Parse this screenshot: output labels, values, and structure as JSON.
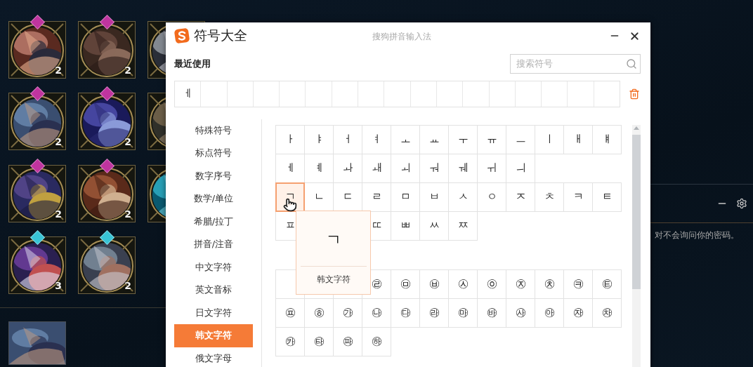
{
  "background": {
    "tiles": [
      {
        "kind": "champion",
        "count": "2",
        "color": "#c0349f"
      },
      {
        "kind": "champion",
        "count": "2",
        "color": "#c0349f"
      },
      {
        "kind": "picture"
      },
      {
        "kind": "champion",
        "count": "2",
        "color": "#c0349f"
      },
      {
        "kind": "champion",
        "count": "2",
        "color": "#c0349f"
      },
      {
        "kind": "picture"
      },
      {
        "kind": "champion",
        "count": "2",
        "color": "#c0349f"
      },
      {
        "kind": "champion",
        "count": "2",
        "color": "#c0349f"
      },
      {
        "kind": "picture"
      },
      {
        "kind": "champion",
        "count": "3",
        "color": "#38c4d6"
      },
      {
        "kind": "champion",
        "count": "2",
        "color": "#38c4d6"
      }
    ],
    "side_panel": {
      "notice": "对不会询问你的密码。"
    }
  },
  "dialog": {
    "title": "符号大全",
    "subtitle": "搜狗拼音输入法",
    "recent": {
      "label": "最近使用",
      "items": [
        "ㅔ"
      ]
    },
    "search": {
      "placeholder": "搜索符号"
    },
    "categories": [
      {
        "label": "特殊符号",
        "selected": false
      },
      {
        "label": "标点符号",
        "selected": false
      },
      {
        "label": "数字序号",
        "selected": false
      },
      {
        "label": "数学/单位",
        "selected": false
      },
      {
        "label": "希腊/拉丁",
        "selected": false
      },
      {
        "label": "拼音/注音",
        "selected": false
      },
      {
        "label": "中文字符",
        "selected": false
      },
      {
        "label": "英文音标",
        "selected": false
      },
      {
        "label": "日文字符",
        "selected": false
      },
      {
        "label": "韩文字符",
        "selected": true
      },
      {
        "label": "俄文字母",
        "selected": false
      }
    ],
    "groups": [
      {
        "cells": [
          {
            "kind": "char",
            "char": "ㅏ",
            "hovered": false
          },
          {
            "kind": "char",
            "char": "ㅑ",
            "hovered": false
          },
          {
            "kind": "char",
            "char": "ㅓ",
            "hovered": false
          },
          {
            "kind": "char",
            "char": "ㅕ",
            "hovered": false
          },
          {
            "kind": "char",
            "char": "ㅗ",
            "hovered": false
          },
          {
            "kind": "char",
            "char": "ㅛ",
            "hovered": false
          },
          {
            "kind": "char",
            "char": "ㅜ",
            "hovered": false
          },
          {
            "kind": "char",
            "char": "ㅠ",
            "hovered": false
          },
          {
            "kind": "char",
            "char": "ㅡ",
            "hovered": false
          },
          {
            "kind": "char",
            "char": "ㅣ",
            "hovered": false
          },
          {
            "kind": "char",
            "char": "ㅐ",
            "hovered": false
          },
          {
            "kind": "char",
            "char": "ㅒ",
            "hovered": false
          },
          {
            "kind": "char",
            "char": "ㅔ",
            "hovered": false
          },
          {
            "kind": "char",
            "char": "ㅖ",
            "hovered": false
          },
          {
            "kind": "char",
            "char": "ㅘ",
            "hovered": false
          },
          {
            "kind": "char",
            "char": "ㅙ",
            "hovered": false
          },
          {
            "kind": "char",
            "char": "ㅚ",
            "hovered": false
          },
          {
            "kind": "char",
            "char": "ㅝ",
            "hovered": false
          },
          {
            "kind": "char",
            "char": "ㅞ",
            "hovered": false
          },
          {
            "kind": "char",
            "char": "ㅟ",
            "hovered": false
          },
          {
            "kind": "char",
            "char": "ㅢ",
            "hovered": false
          },
          {
            "kind": "break"
          },
          {
            "kind": "char",
            "char": "ㄱ",
            "hovered": true
          },
          {
            "kind": "char",
            "char": "ㄴ",
            "hovered": false
          },
          {
            "kind": "char",
            "char": "ㄷ",
            "hovered": false
          },
          {
            "kind": "char",
            "char": "ㄹ",
            "hovered": false
          },
          {
            "kind": "char",
            "char": "ㅁ",
            "hovered": false
          },
          {
            "kind": "char",
            "char": "ㅂ",
            "hovered": false
          },
          {
            "kind": "char",
            "char": "ㅅ",
            "hovered": false
          },
          {
            "kind": "char",
            "char": "ㅇ",
            "hovered": false
          },
          {
            "kind": "char",
            "char": "ㅈ",
            "hovered": false
          },
          {
            "kind": "char",
            "char": "ㅊ",
            "hovered": false
          },
          {
            "kind": "char",
            "char": "ㅋ",
            "hovered": false
          },
          {
            "kind": "char",
            "char": "ㅌ",
            "hovered": false
          },
          {
            "kind": "char",
            "char": "ㅍ",
            "hovered": false
          },
          {
            "kind": "covered"
          },
          {
            "kind": "covered"
          },
          {
            "kind": "char",
            "char": "ㄸ",
            "hovered": false
          },
          {
            "kind": "char",
            "char": "ㅃ",
            "hovered": false
          },
          {
            "kind": "char",
            "char": "ㅆ",
            "hovered": false
          },
          {
            "kind": "char",
            "char": "ㅉ",
            "hovered": false
          }
        ]
      },
      {
        "cells": [
          {
            "kind": "partial"
          },
          {
            "kind": "covered"
          },
          {
            "kind": "covered"
          },
          {
            "kind": "char",
            "char": "㉣",
            "hovered": false
          },
          {
            "kind": "char",
            "char": "㉤",
            "hovered": false
          },
          {
            "kind": "char",
            "char": "㉥",
            "hovered": false
          },
          {
            "kind": "char",
            "char": "㉦",
            "hovered": false
          },
          {
            "kind": "char",
            "char": "㉧",
            "hovered": false
          },
          {
            "kind": "char",
            "char": "㉨",
            "hovered": false
          },
          {
            "kind": "char",
            "char": "㉩",
            "hovered": false
          },
          {
            "kind": "char",
            "char": "㉪",
            "hovered": false
          },
          {
            "kind": "char",
            "char": "㉫",
            "hovered": false
          },
          {
            "kind": "char",
            "char": "㉬",
            "hovered": false
          },
          {
            "kind": "char",
            "char": "㉭",
            "hovered": false
          },
          {
            "kind": "char",
            "char": "㉮",
            "hovered": false
          },
          {
            "kind": "char",
            "char": "㉯",
            "hovered": false
          },
          {
            "kind": "char",
            "char": "㉰",
            "hovered": false
          },
          {
            "kind": "char",
            "char": "㉱",
            "hovered": false
          },
          {
            "kind": "char",
            "char": "㉲",
            "hovered": false
          },
          {
            "kind": "char",
            "char": "㉳",
            "hovered": false
          },
          {
            "kind": "char",
            "char": "㉴",
            "hovered": false
          },
          {
            "kind": "char",
            "char": "㉵",
            "hovered": false
          },
          {
            "kind": "char",
            "char": "㉶",
            "hovered": false
          },
          {
            "kind": "char",
            "char": "㉷",
            "hovered": false
          },
          {
            "kind": "char",
            "char": "㉸",
            "hovered": false
          },
          {
            "kind": "char",
            "char": "㉹",
            "hovered": false
          },
          {
            "kind": "char",
            "char": "㉺",
            "hovered": false
          },
          {
            "kind": "char",
            "char": "㉻",
            "hovered": false
          }
        ]
      }
    ],
    "popup": {
      "char": "ㄱ",
      "label": "韩文字符"
    }
  }
}
